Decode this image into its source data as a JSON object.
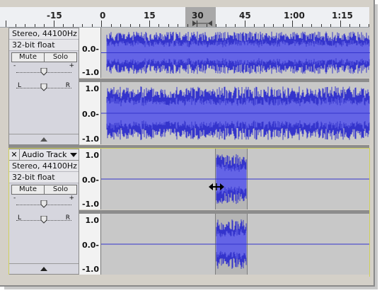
{
  "ruler": {
    "labels": [
      {
        "text": "-15"
      },
      {
        "text": "0"
      },
      {
        "text": "15"
      },
      {
        "text": "30"
      },
      {
        "text": "45"
      },
      {
        "text": "1:00"
      },
      {
        "text": "1:15"
      }
    ]
  },
  "track1": {
    "format": "Stereo, 44100Hz",
    "bitdepth": "32-bit float",
    "mute": "Mute",
    "solo": "Solo",
    "gain_minus": "-",
    "gain_plus": "+",
    "pan_left": "L",
    "pan_right": "R",
    "scale_top": [
      "0.0-",
      "-1.0"
    ],
    "scale_bottom": [
      "1.0",
      "0.0-",
      "-1.0"
    ]
  },
  "track2": {
    "close": "✕",
    "name": "Audio Track",
    "format": "Stereo, 44100Hz",
    "bitdepth": "32-bit float",
    "mute": "Mute",
    "solo": "Solo",
    "gain_minus": "-",
    "gain_plus": "+",
    "pan_left": "L",
    "pan_right": "R",
    "scale_top": [
      "1.0",
      "0.0-",
      "-1.0"
    ],
    "scale_bottom": [
      "1.0",
      "0.0-",
      "-1.0"
    ]
  },
  "colors": {
    "wave": "#3434cc",
    "wave_inner": "#6464e6",
    "selection": "#b6b6b6",
    "background": "#c8c8c8"
  },
  "cursor": "resize-horizontal-icon"
}
